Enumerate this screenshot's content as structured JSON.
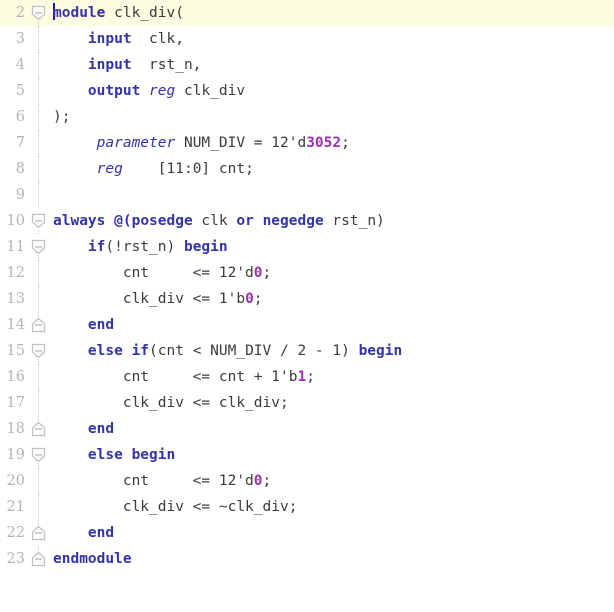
{
  "editor": {
    "language": "Verilog",
    "current_line": 2,
    "first_visible_line": 2,
    "last_visible_line": 23,
    "colors": {
      "background": "#ffffff",
      "current_line_highlight": "#fdfbe0",
      "keyword": "#3333aa",
      "number": "#9b30b0",
      "text": "#3b3b3b",
      "line_number": "#b4b4b4",
      "fold_marker": "#c0c0c0",
      "caret": "#1a1a8c"
    },
    "lines": [
      {
        "number": "2",
        "fold": "start",
        "current": true,
        "caret": true,
        "indent": "",
        "tokens": [
          {
            "t": "module",
            "c": "kw"
          },
          {
            "t": " ",
            "c": "plain"
          },
          {
            "t": "clk_div(",
            "c": "plain"
          }
        ]
      },
      {
        "number": "3",
        "fold": "none",
        "current": false,
        "caret": false,
        "indent": "    ",
        "tokens": [
          {
            "t": "input",
            "c": "kw"
          },
          {
            "t": "  clk,",
            "c": "plain"
          }
        ]
      },
      {
        "number": "4",
        "fold": "none",
        "current": false,
        "caret": false,
        "indent": "    ",
        "tokens": [
          {
            "t": "input",
            "c": "kw"
          },
          {
            "t": "  rst_n,",
            "c": "plain"
          }
        ]
      },
      {
        "number": "5",
        "fold": "none",
        "current": false,
        "caret": false,
        "indent": "    ",
        "tokens": [
          {
            "t": "output",
            "c": "kw"
          },
          {
            "t": " ",
            "c": "plain"
          },
          {
            "t": "reg",
            "c": "kwi"
          },
          {
            "t": " clk_div",
            "c": "plain"
          }
        ]
      },
      {
        "number": "6",
        "fold": "none",
        "current": false,
        "caret": false,
        "indent": "",
        "tokens": [
          {
            "t": ");",
            "c": "plain"
          }
        ]
      },
      {
        "number": "7",
        "fold": "none",
        "current": false,
        "caret": false,
        "indent": "     ",
        "tokens": [
          {
            "t": "parameter",
            "c": "kwi"
          },
          {
            "t": " NUM_DIV = 12'd",
            "c": "plain"
          },
          {
            "t": "3052",
            "c": "num"
          },
          {
            "t": ";",
            "c": "plain"
          }
        ]
      },
      {
        "number": "8",
        "fold": "none",
        "current": false,
        "caret": false,
        "indent": "     ",
        "tokens": [
          {
            "t": "reg",
            "c": "kwi"
          },
          {
            "t": "    [11:0] cnt;",
            "c": "plain"
          }
        ]
      },
      {
        "number": "9",
        "fold": "none",
        "current": false,
        "caret": false,
        "indent": "",
        "tokens": []
      },
      {
        "number": "10",
        "fold": "start",
        "current": false,
        "caret": false,
        "indent": "",
        "tokens": [
          {
            "t": "always",
            "c": "kw"
          },
          {
            "t": " ",
            "c": "plain"
          },
          {
            "t": "@(",
            "c": "kw"
          },
          {
            "t": "posedge",
            "c": "kw"
          },
          {
            "t": " clk ",
            "c": "plain"
          },
          {
            "t": "or",
            "c": "kw"
          },
          {
            "t": " ",
            "c": "plain"
          },
          {
            "t": "negedge",
            "c": "kw"
          },
          {
            "t": " rst_n)",
            "c": "plain"
          }
        ]
      },
      {
        "number": "11",
        "fold": "start",
        "current": false,
        "caret": false,
        "indent": "    ",
        "tokens": [
          {
            "t": "if",
            "c": "kw"
          },
          {
            "t": "(!rst_n) ",
            "c": "plain"
          },
          {
            "t": "begin",
            "c": "kw"
          }
        ]
      },
      {
        "number": "12",
        "fold": "none",
        "current": false,
        "caret": false,
        "indent": "        ",
        "tokens": [
          {
            "t": "cnt     <= 12'd",
            "c": "plain"
          },
          {
            "t": "0",
            "c": "num"
          },
          {
            "t": ";",
            "c": "plain"
          }
        ]
      },
      {
        "number": "13",
        "fold": "none",
        "current": false,
        "caret": false,
        "indent": "        ",
        "tokens": [
          {
            "t": "clk_div <= 1'b",
            "c": "plain"
          },
          {
            "t": "0",
            "c": "num"
          },
          {
            "t": ";",
            "c": "plain"
          }
        ]
      },
      {
        "number": "14",
        "fold": "end",
        "current": false,
        "caret": false,
        "indent": "    ",
        "tokens": [
          {
            "t": "end",
            "c": "kw"
          }
        ]
      },
      {
        "number": "15",
        "fold": "start",
        "current": false,
        "caret": false,
        "indent": "    ",
        "tokens": [
          {
            "t": "else",
            "c": "kw"
          },
          {
            "t": " ",
            "c": "plain"
          },
          {
            "t": "if",
            "c": "kw"
          },
          {
            "t": "(cnt < NUM_DIV / 2 - 1) ",
            "c": "plain"
          },
          {
            "t": "begin",
            "c": "kw"
          }
        ]
      },
      {
        "number": "16",
        "fold": "none",
        "current": false,
        "caret": false,
        "indent": "        ",
        "tokens": [
          {
            "t": "cnt     <= cnt + 1'b",
            "c": "plain"
          },
          {
            "t": "1",
            "c": "num"
          },
          {
            "t": ";",
            "c": "plain"
          }
        ]
      },
      {
        "number": "17",
        "fold": "none",
        "current": false,
        "caret": false,
        "indent": "        ",
        "tokens": [
          {
            "t": "clk_div <= clk_div;",
            "c": "plain"
          }
        ]
      },
      {
        "number": "18",
        "fold": "end",
        "current": false,
        "caret": false,
        "indent": "    ",
        "tokens": [
          {
            "t": "end",
            "c": "kw"
          }
        ]
      },
      {
        "number": "19",
        "fold": "start",
        "current": false,
        "caret": false,
        "indent": "    ",
        "tokens": [
          {
            "t": "else",
            "c": "kw"
          },
          {
            "t": " ",
            "c": "plain"
          },
          {
            "t": "begin",
            "c": "kw"
          }
        ]
      },
      {
        "number": "20",
        "fold": "none",
        "current": false,
        "caret": false,
        "indent": "        ",
        "tokens": [
          {
            "t": "cnt     <= 12'd",
            "c": "plain"
          },
          {
            "t": "0",
            "c": "num"
          },
          {
            "t": ";",
            "c": "plain"
          }
        ]
      },
      {
        "number": "21",
        "fold": "none",
        "current": false,
        "caret": false,
        "indent": "        ",
        "tokens": [
          {
            "t": "clk_div <= ~clk_div;",
            "c": "plain"
          }
        ]
      },
      {
        "number": "22",
        "fold": "end",
        "current": false,
        "caret": false,
        "indent": "    ",
        "tokens": [
          {
            "t": "end",
            "c": "kw"
          }
        ]
      },
      {
        "number": "23",
        "fold": "end",
        "current": false,
        "caret": false,
        "indent": "",
        "tokens": [
          {
            "t": "endmodule",
            "c": "kw"
          }
        ]
      }
    ]
  }
}
